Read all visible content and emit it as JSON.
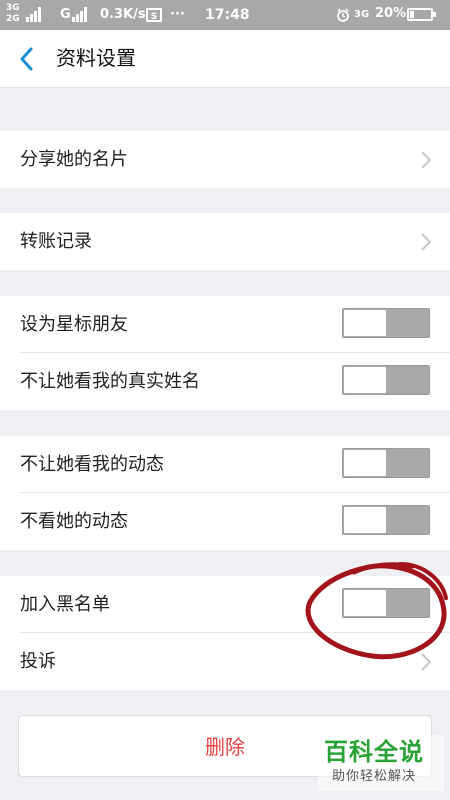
{
  "status_bar": {
    "net_top": "3G",
    "net_bottom": "2G",
    "net_g": "G",
    "speed": "0.3K/s",
    "more": "···",
    "time": "17:48",
    "net_right": "3G",
    "battery": "20%",
    "battery_level_percent": 20
  },
  "nav": {
    "title": "资料设置"
  },
  "rows": {
    "share_card": "分享她的名片",
    "transfer_records": "转账记录",
    "star_friend": "设为星标朋友",
    "hide_real_name": "不让她看我的真实姓名",
    "hide_my_moments": "不让她看我的动态",
    "mute_her_moments": "不看她的动态",
    "blacklist": "加入黑名单",
    "report": "投诉"
  },
  "toggles": {
    "star_friend": false,
    "hide_real_name": false,
    "hide_my_moments": false,
    "mute_her_moments": false,
    "blacklist": false
  },
  "delete_button": {
    "label": "删除"
  },
  "watermark": {
    "title": "百科全说",
    "subtitle": "助你轻松解决"
  },
  "colors": {
    "accent": "#1a8fd6",
    "danger": "#e64340",
    "toggle_off": "#a9a9a9",
    "annotation": "#a3141a",
    "watermark": "#2aa336"
  }
}
